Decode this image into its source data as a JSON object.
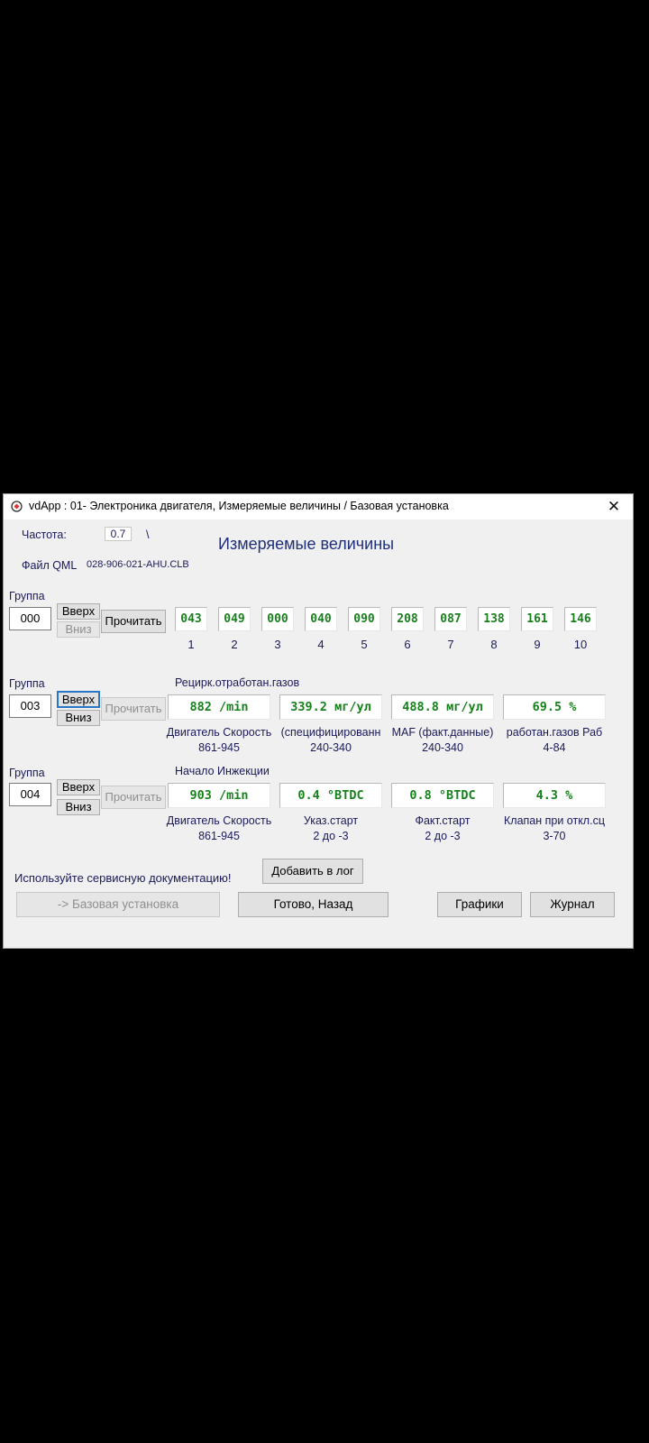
{
  "window": {
    "title": "vdApp : 01- Электроника двигателя,  Измеряемые величины / Базовая установка",
    "close_glyph": "✕"
  },
  "header": {
    "freq_label": "Частота:",
    "freq_value": "0.7",
    "freq_indicator": "\\",
    "file_label": "Файл QML",
    "file_value": "028-906-021-AHU.CLB",
    "heading": "Измеряемые величины"
  },
  "group1": {
    "label": "Группа",
    "number": "000",
    "up": "Вверх",
    "down": "Вниз",
    "read": "Прочитать",
    "cells": [
      "043",
      "049",
      "000",
      "040",
      "090",
      "208",
      "087",
      "138",
      "161",
      "146"
    ],
    "indices": [
      "1",
      "2",
      "3",
      "4",
      "5",
      "6",
      "7",
      "8",
      "9",
      "10"
    ]
  },
  "group2": {
    "label": "Группа",
    "number": "003",
    "up": "Вверх",
    "down": "Вниз",
    "read": "Прочитать",
    "title": "Рецирк.отработан.газов",
    "values": [
      "882 /min",
      "339.2 мг/ул",
      "488.8 мг/ул",
      "69.5 %"
    ],
    "names": [
      "Двигатель Скорость",
      "(специфицированн",
      "MAF (факт.данные)",
      "работан.газов Раб"
    ],
    "ranges": [
      "861-945",
      "240-340",
      "240-340",
      "4-84"
    ]
  },
  "group3": {
    "label": "Группа",
    "number": "004",
    "up": "Вверх",
    "down": "Вниз",
    "read": "Прочитать",
    "title": "Начало Инжекции",
    "values": [
      "903 /min",
      "0.4 °BTDC",
      "0.8 °BTDC",
      "4.3 %"
    ],
    "names": [
      "Двигатель Скорость",
      "Указ.старт",
      "Факт.старт",
      "Клапан при откл.сц"
    ],
    "ranges": [
      "861-945",
      "2 до -3",
      "2 до -3",
      "3-70"
    ]
  },
  "footer": {
    "hint": "Используйте сервисную документацию!",
    "add_log": "Добавить в лог",
    "basic_setting": "-> Базовая установка",
    "done_back": "Готово, Назад",
    "graphs": "Графики",
    "journal": "Журнал"
  }
}
